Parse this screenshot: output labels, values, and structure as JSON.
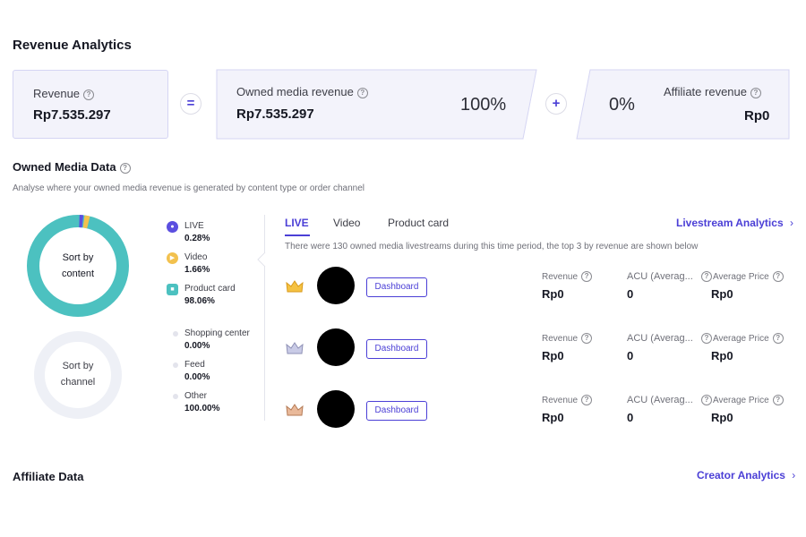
{
  "revenue_analytics": {
    "title": "Revenue Analytics",
    "revenue": {
      "label": "Revenue",
      "value": "Rp7.535.297"
    },
    "equals_symbol": "=",
    "owned": {
      "label": "Owned media revenue",
      "value": "Rp7.535.297",
      "percent": "100%"
    },
    "plus_symbol": "+",
    "affiliate": {
      "label": "Affiliate revenue",
      "value": "Rp0",
      "percent": "0%"
    }
  },
  "owned_media": {
    "title": "Owned Media Data",
    "description": "Analyse where your owned media revenue is generated by content type or order channel",
    "donut_content": {
      "label_line1": "Sort by",
      "label_line2": "content",
      "shares": {
        "live": 0.28,
        "video": 1.66,
        "product_card": 98.06
      }
    },
    "donut_channel": {
      "label_line1": "Sort by",
      "label_line2": "channel"
    },
    "content_legend": [
      {
        "label": "LIVE",
        "value": "0.28%",
        "color": "#5b4fe0",
        "icon": "live-icon"
      },
      {
        "label": "Video",
        "value": "1.66%",
        "color": "#f2c14e",
        "icon": "video-icon"
      },
      {
        "label": "Product card",
        "value": "98.06%",
        "color": "#4cc1c0",
        "icon": "product-card-icon"
      }
    ],
    "channel_legend": [
      {
        "label": "Shopping center",
        "value": "0.00%"
      },
      {
        "label": "Feed",
        "value": "0.00%"
      },
      {
        "label": "Other",
        "value": "100.00%"
      }
    ],
    "tabs": [
      "LIVE",
      "Video",
      "Product card"
    ],
    "livestream_link": "Livestream Analytics",
    "tab_description": "There were 130 owned media livestreams during this time period, the top 3 by revenue are shown below",
    "rows": [
      {
        "rank_icon": "gold-crown-icon",
        "button": "Dashboard",
        "revenue_label": "Revenue",
        "revenue": "Rp0",
        "acu_label": "ACU (Averag...",
        "acu": "0",
        "price_label": "Average Price",
        "price": "Rp0"
      },
      {
        "rank_icon": "silver-crown-icon",
        "button": "Dashboard",
        "revenue_label": "Revenue",
        "revenue": "Rp0",
        "acu_label": "ACU (Averag...",
        "acu": "0",
        "price_label": "Average Price",
        "price": "Rp0"
      },
      {
        "rank_icon": "bronze-crown-icon",
        "button": "Dashboard",
        "revenue_label": "Revenue",
        "revenue": "Rp0",
        "acu_label": "ACU (Averag...",
        "acu": "0",
        "price_label": "Average Price",
        "price": "Rp0"
      }
    ]
  },
  "affiliate_section": {
    "title": "Affiliate Data",
    "link": "Creator Analytics"
  },
  "colors": {
    "accent": "#4b3fd6",
    "live": "#5b4fe0",
    "video": "#f2c14e",
    "product_card": "#4cc1c0"
  }
}
